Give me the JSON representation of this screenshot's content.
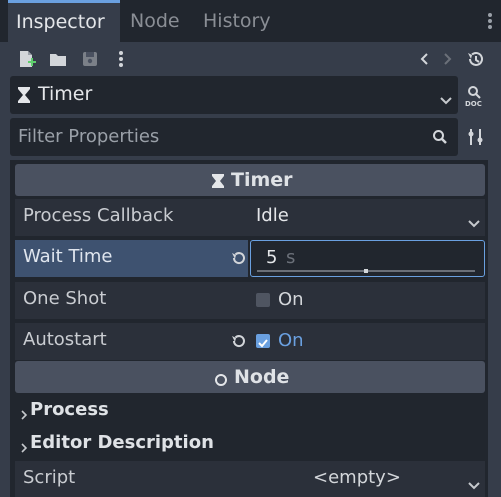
{
  "tabs": [
    {
      "label": "Inspector"
    },
    {
      "label": "Node"
    },
    {
      "label": "History"
    }
  ],
  "object_selector": {
    "label": "Timer"
  },
  "filter": {
    "placeholder": "Filter Properties"
  },
  "sections": {
    "timer": {
      "title": "Timer"
    },
    "node": {
      "title": "Node"
    }
  },
  "properties": {
    "process_callback": {
      "label": "Process Callback",
      "value": "Idle"
    },
    "wait_time": {
      "label": "Wait Time",
      "value": "5",
      "unit": "s",
      "slider_fraction": 0.5
    },
    "one_shot": {
      "label": "One Shot",
      "value": "On",
      "checked": false
    },
    "autostart": {
      "label": "Autostart",
      "value": "On",
      "checked": true
    }
  },
  "groups": {
    "process": "Process",
    "editor_description": "Editor Description"
  },
  "script": {
    "label": "Script",
    "value": "<empty>"
  },
  "colors": {
    "accent": "#6aa0e0",
    "highlight_row": "#3e5270"
  }
}
